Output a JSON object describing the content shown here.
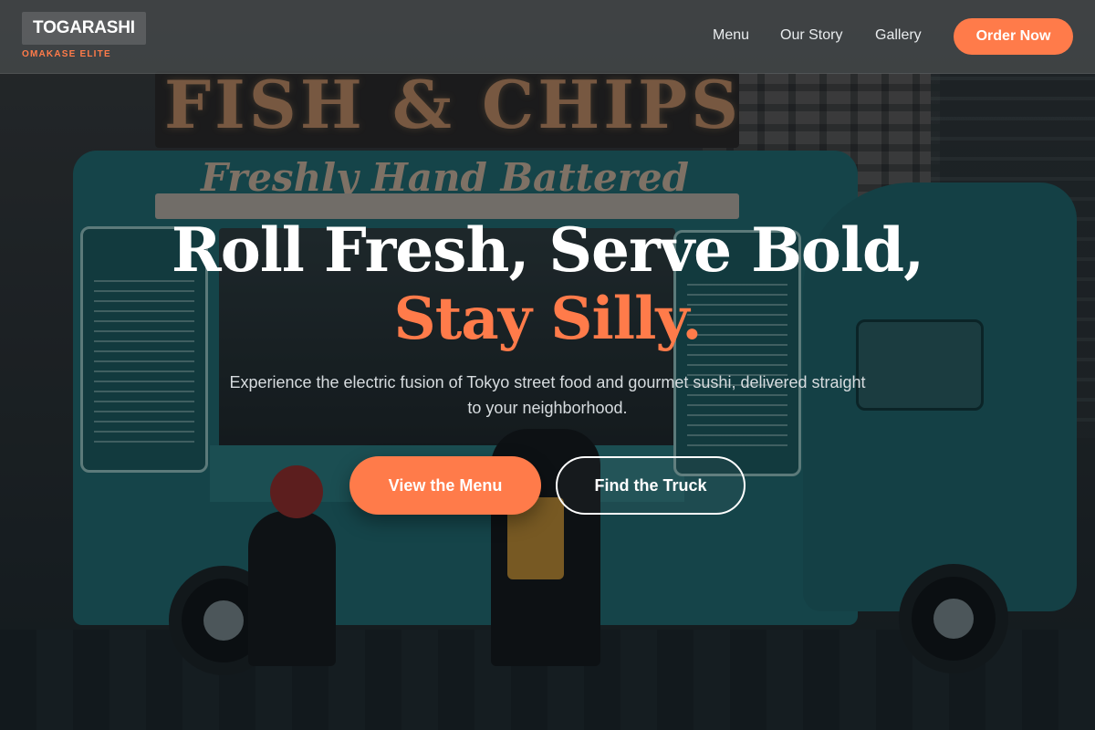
{
  "brand": {
    "name": "TOGARASHI",
    "subtitle": "OMAKASE ELITE",
    "accent_color": "#ff7b4a"
  },
  "nav": {
    "links": [
      {
        "label": "Menu"
      },
      {
        "label": "Our Story"
      },
      {
        "label": "Gallery"
      }
    ],
    "cta_label": "Order Now"
  },
  "hero": {
    "headline": "Roll Fresh, Serve Bold,",
    "headline_accent": "Stay Silly.",
    "tagline": "Experience the electric fusion of Tokyo street food and gourmet sushi, delivered straight to your neighborhood.",
    "primary_button": "View the Menu",
    "secondary_button": "Find the Truck",
    "background": {
      "sign_text": "FISH & CHIPS",
      "truck_script": "Freshly Hand Battered"
    }
  }
}
